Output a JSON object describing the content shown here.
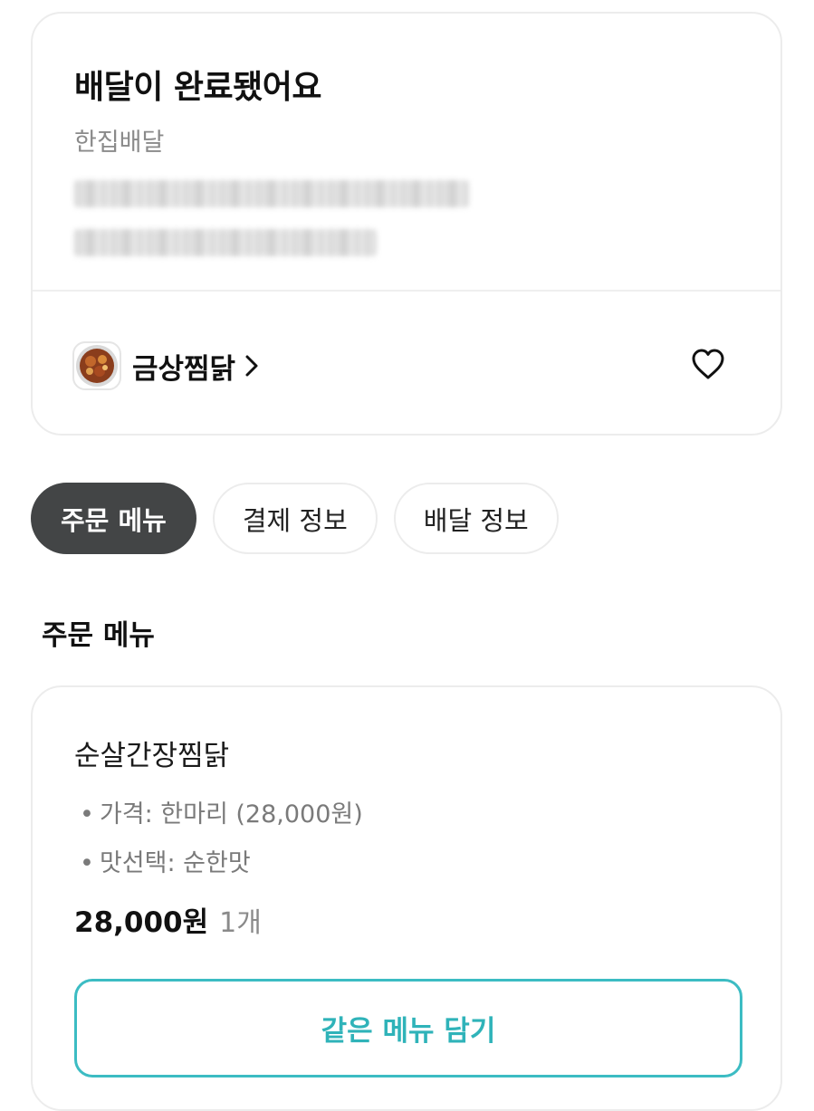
{
  "status": {
    "title": "배달이 완료됐어요",
    "delivery_type": "한집배달"
  },
  "store": {
    "name": "금상찜닭"
  },
  "tabs": [
    {
      "label": "주문 메뉴",
      "active": true
    },
    {
      "label": "결제 정보",
      "active": false
    },
    {
      "label": "배달 정보",
      "active": false
    }
  ],
  "order_menu": {
    "section_title": "주문 메뉴",
    "item": {
      "name": "순살간장찜닭",
      "options": [
        "가격: 한마리 (28,000원)",
        "맛선택: 순한맛"
      ],
      "price": "28,000원",
      "quantity": "1개"
    },
    "reorder_label": "같은 메뉴 담기"
  },
  "colors": {
    "accent": "#3cbcc3",
    "active_tab": "#434546"
  }
}
